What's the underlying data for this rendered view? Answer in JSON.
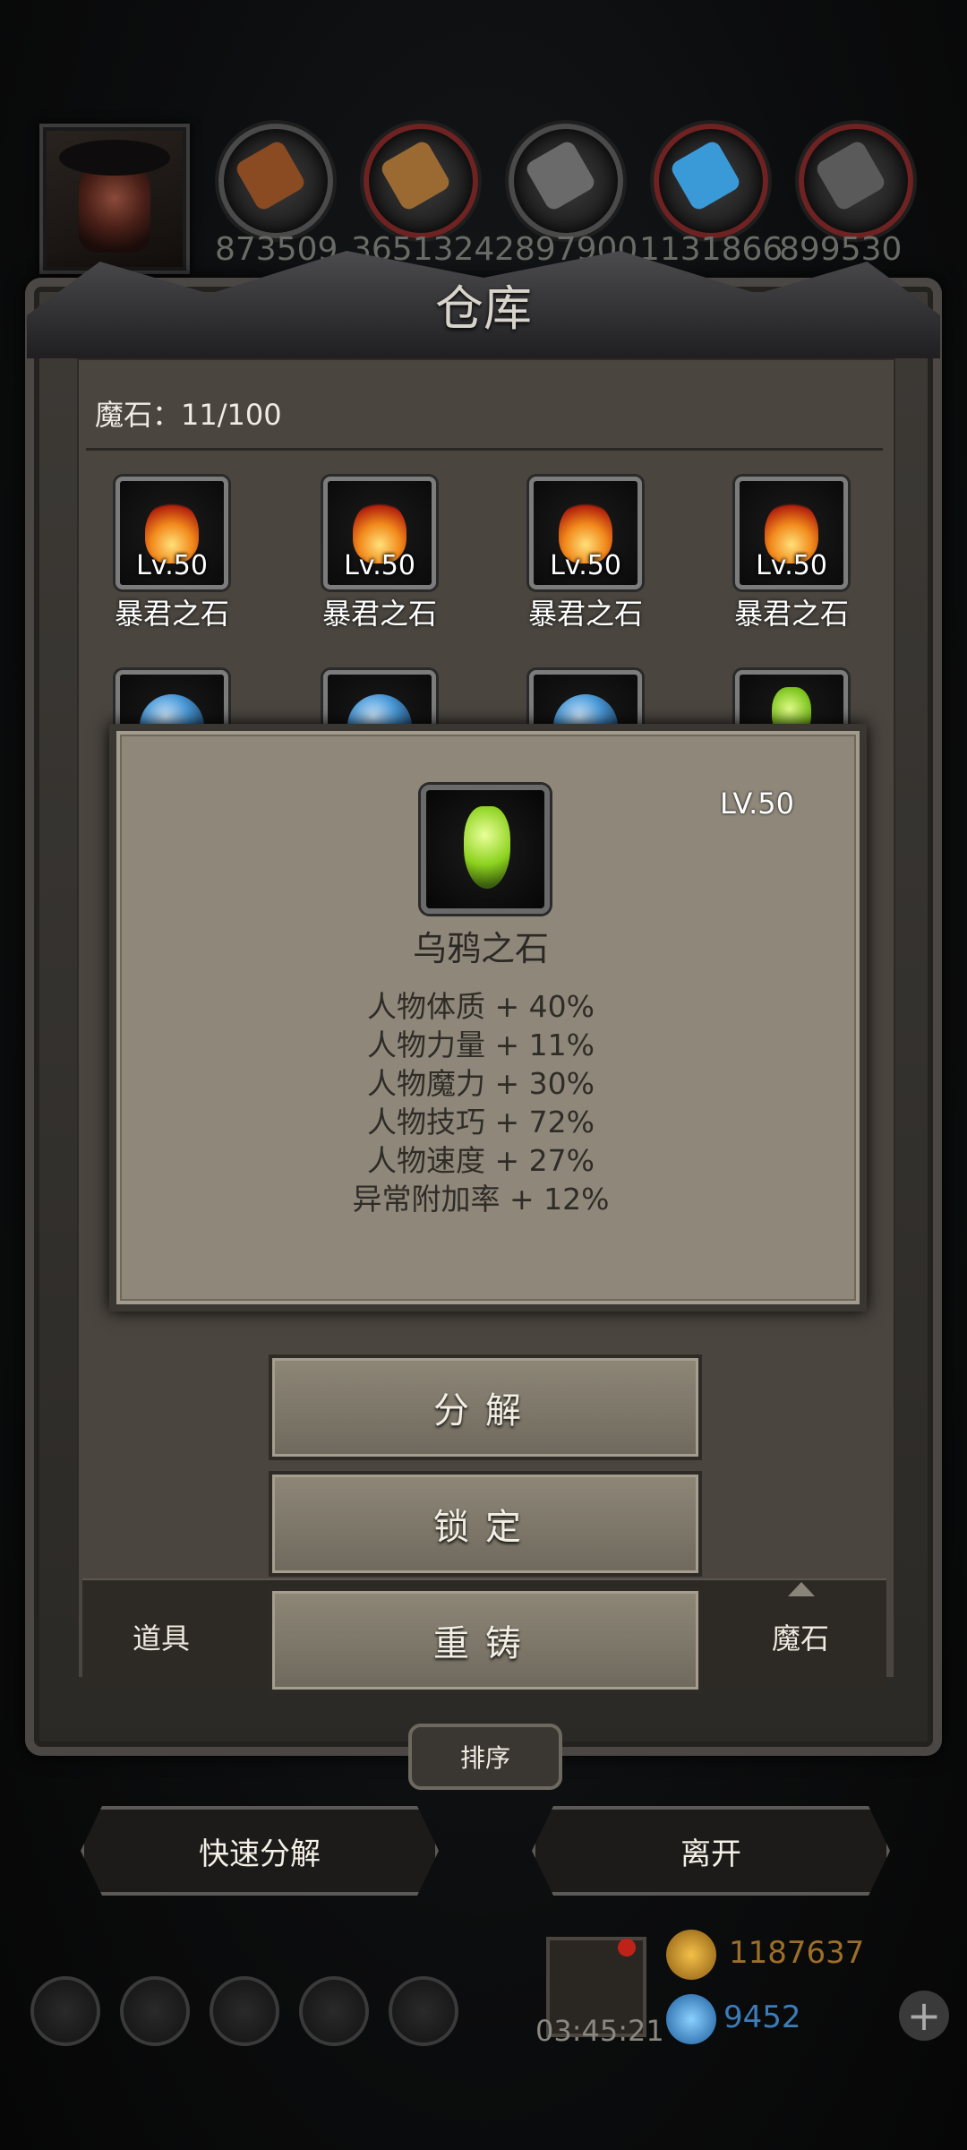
{
  "resources": [
    "873509",
    "3651324",
    "2897900",
    "1131866",
    "899530"
  ],
  "title": "仓库",
  "count_label": "魔石：11/100",
  "items_row1": [
    {
      "name": "暴君之石",
      "level": "Lv.50"
    },
    {
      "name": "暴君之石",
      "level": "Lv.50"
    },
    {
      "name": "暴君之石",
      "level": "Lv.50"
    },
    {
      "name": "暴君之石",
      "level": "Lv.50"
    }
  ],
  "popup": {
    "level": "LV.50",
    "name": "乌鸦之石",
    "stats": [
      "人物体质 + 40%",
      "人物力量 + 11%",
      "人物魔力 + 30%",
      "人物技巧 + 72%",
      "人物速度 + 27%",
      "异常附加率 + 12%"
    ]
  },
  "actions": {
    "decompose": "分解",
    "lock": "锁定",
    "reforge": "重铸"
  },
  "tabs": {
    "items": "道具",
    "magic_stone": "魔石"
  },
  "sort_label": "排序",
  "buttons": {
    "quick_decompose": "快速分解",
    "leave": "离开"
  },
  "bottom": {
    "timer": "03:45:21",
    "gold": "1187637",
    "gems": "9452"
  }
}
